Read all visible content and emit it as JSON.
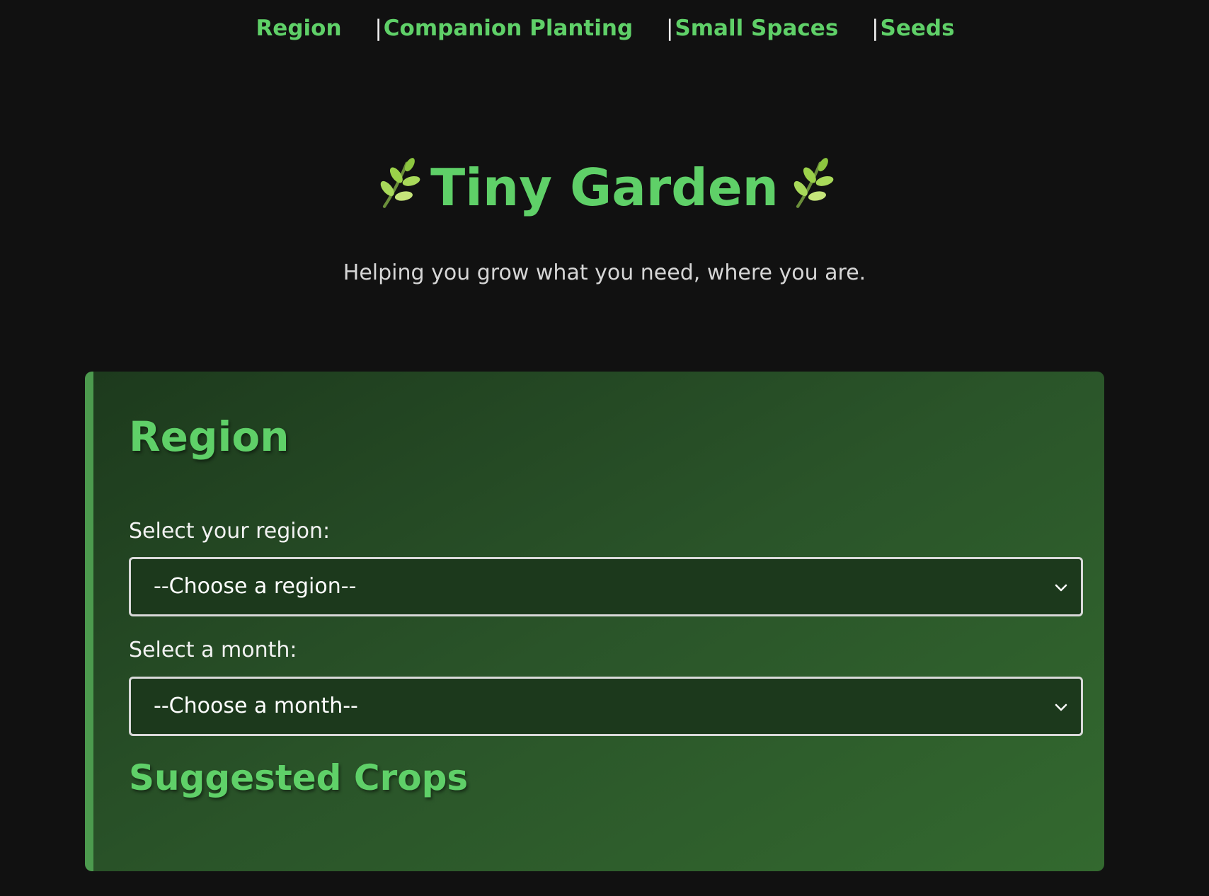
{
  "nav": {
    "items": [
      {
        "label": "Region",
        "separator": ""
      },
      {
        "label": "Companion Planting",
        "separator": "|"
      },
      {
        "label": "Small Spaces",
        "separator": "|"
      },
      {
        "label": "Seeds",
        "separator": "|"
      }
    ]
  },
  "header": {
    "title": "Tiny Garden",
    "subtitle": "Helping you grow what you need, where you are.",
    "icon": "herb-icon"
  },
  "region_card": {
    "heading": "Region",
    "region_label": "Select your region:",
    "region_select_value": "--Choose a region--",
    "month_label": "Select a month:",
    "month_select_value": "--Choose a month--",
    "results_heading": "Suggested Crops"
  },
  "colors": {
    "accent": "#5fd068",
    "background": "#111111",
    "card_border": "#4c9a4e"
  }
}
